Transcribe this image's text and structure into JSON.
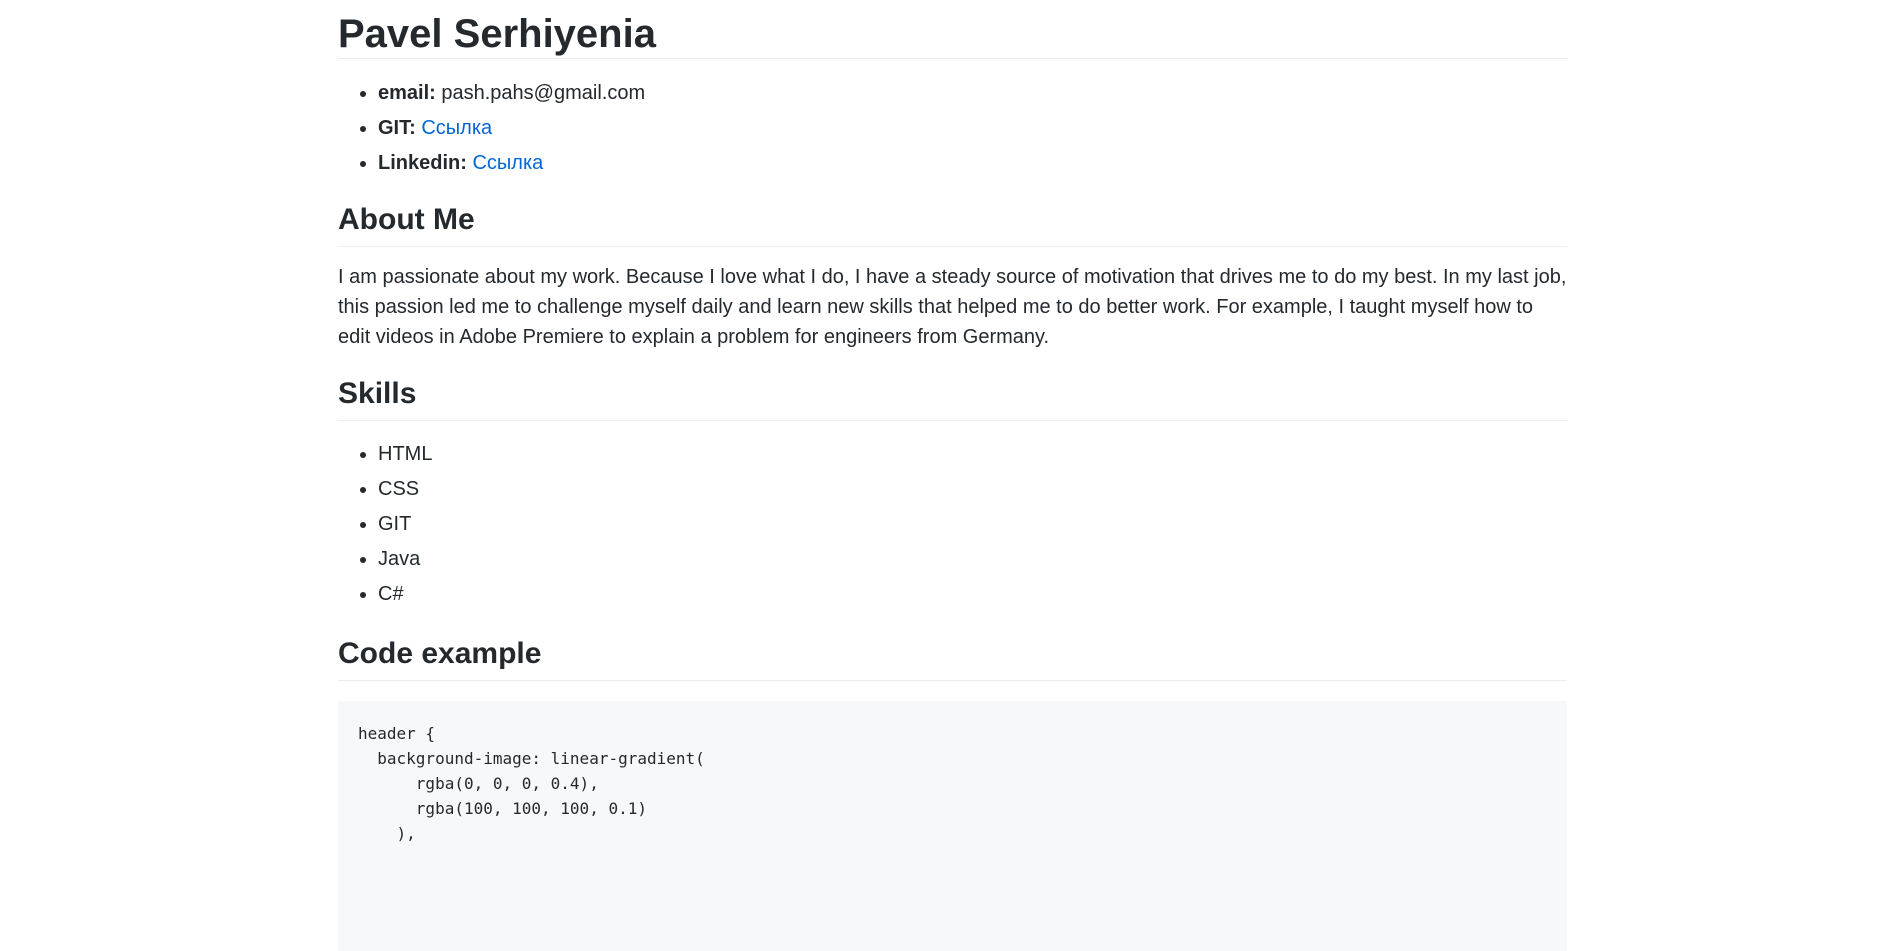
{
  "profile": {
    "name": "Pavel Serhiyenia"
  },
  "contacts": {
    "email_label": "email:",
    "email_value": "pash.pahs@gmail.com",
    "git_label": "GIT:",
    "git_link": "Ссылка",
    "linkedin_label": "Linkedin:",
    "linkedin_link": "Ссылка"
  },
  "about": {
    "heading": "About Me",
    "text": "I am passionate about my work. Because I love what I do, I have a steady source of motivation that drives me to do my best. In my last job, this passion led me to challenge myself daily and learn new skills that helped me to do better work. For example, I taught myself how to edit videos in Adobe Premiere to explain a problem for engineers from Germany."
  },
  "skills": {
    "heading": "Skills",
    "items": [
      "HTML",
      "CSS",
      "GIT",
      "Java",
      "C#"
    ]
  },
  "code": {
    "heading": "Code example",
    "snippet": "header {\n  background-image: linear-gradient(\n      rgba(0, 0, 0, 0.4),\n      rgba(100, 100, 100, 0.1)\n    ),"
  }
}
